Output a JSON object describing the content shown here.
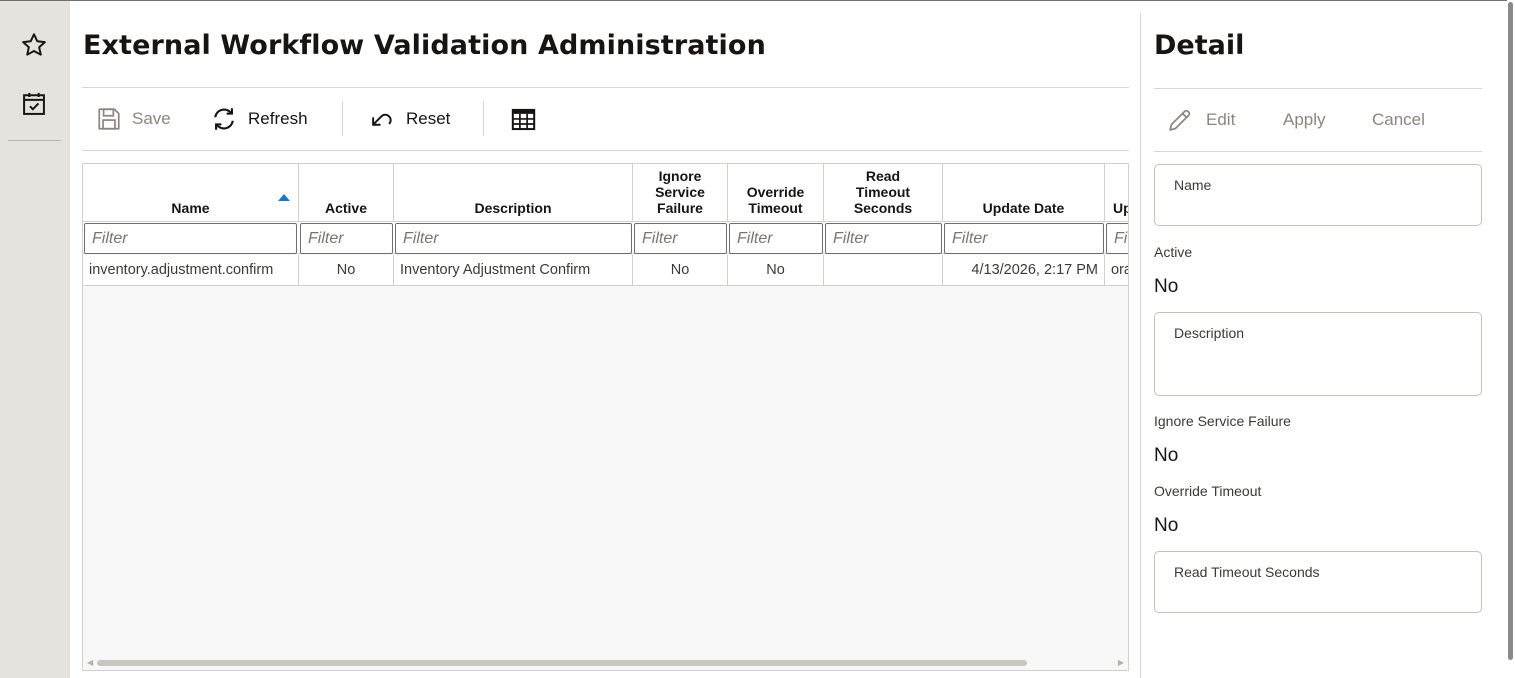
{
  "page": {
    "title": "External Workflow Validation Administration"
  },
  "rail": {
    "items": [
      {
        "name": "favorites",
        "icon": "star-icon"
      },
      {
        "name": "tasks",
        "icon": "calendar-check-icon"
      }
    ]
  },
  "toolbar": {
    "save_label": "Save",
    "refresh_label": "Refresh",
    "reset_label": "Reset",
    "columns_icon": "table-icon"
  },
  "table": {
    "columns": [
      {
        "key": "name",
        "label": "Name",
        "sorted": "ascending"
      },
      {
        "key": "active",
        "label": "Active"
      },
      {
        "key": "description",
        "label": "Description"
      },
      {
        "key": "ignore_service_failure",
        "label": "Ignore Service Failure"
      },
      {
        "key": "override_timeout",
        "label": "Override Timeout"
      },
      {
        "key": "read_timeout_seconds",
        "label": "Read Timeout Seconds"
      },
      {
        "key": "update_date",
        "label": "Update Date"
      },
      {
        "key": "updated_by",
        "label": "Up"
      }
    ],
    "filter_placeholder": "Filter",
    "filter_placeholder_truncated": "Fi",
    "rows": [
      {
        "name": "inventory.adjustment.confirm",
        "active": "No",
        "description": "Inventory Adjustment Confirm",
        "ignore_service_failure": "No",
        "override_timeout": "No",
        "read_timeout_seconds": "",
        "update_date": "4/13/2026, 2:17 PM",
        "updated_by": "ora"
      }
    ]
  },
  "detail": {
    "title": "Detail",
    "edit_label": "Edit",
    "apply_label": "Apply",
    "cancel_label": "Cancel",
    "fields": {
      "name_label": "Name",
      "name_value": "",
      "active_label": "Active",
      "active_value": "No",
      "description_label": "Description",
      "description_value": "",
      "ignore_service_failure_label": "Ignore Service Failure",
      "ignore_service_failure_value": "No",
      "override_timeout_label": "Override Timeout",
      "override_timeout_value": "No",
      "read_timeout_seconds_label": "Read Timeout Seconds",
      "read_timeout_seconds_value": ""
    }
  },
  "colors": {
    "rail_bg": "#e6e3df",
    "sort_accent": "#1b76c8",
    "text_primary": "#161513",
    "text_disabled": "#8b8680"
  }
}
